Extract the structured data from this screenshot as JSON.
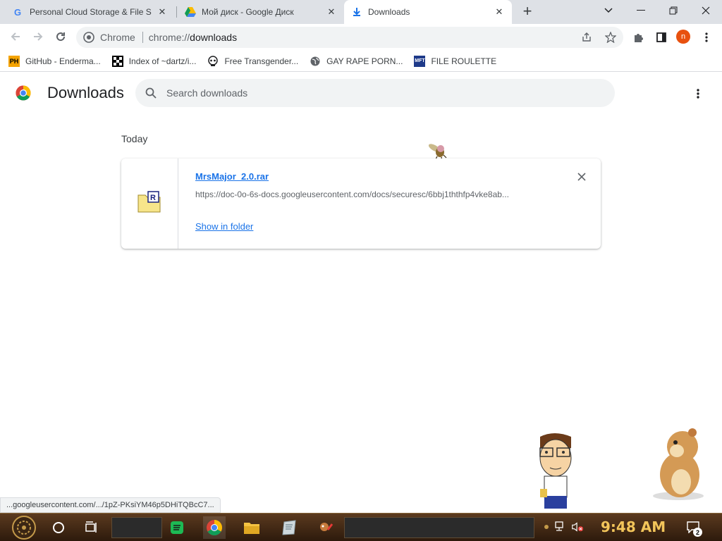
{
  "tabs": [
    {
      "title": "Personal Cloud Storage & File S",
      "favicon": "google-g-icon",
      "active": false
    },
    {
      "title": "Мой диск - Google Диск",
      "favicon": "google-drive-icon",
      "active": false
    },
    {
      "title": "Downloads",
      "favicon": "download-icon",
      "active": true
    }
  ],
  "omnibox": {
    "chip_label": "Chrome",
    "url_prefix": "chrome://",
    "url_host": "downloads"
  },
  "bookmarks": [
    {
      "label": "GitHub - Enderma...",
      "icon": "ph-icon"
    },
    {
      "label": "Index of ~dartz/i...",
      "icon": "pixel-grid-icon"
    },
    {
      "label": "Free Transgender...",
      "icon": "skull-icon"
    },
    {
      "label": "GAY RAPE PORN...",
      "icon": "globe-icon"
    },
    {
      "label": "FILE ROULETTE",
      "icon": "mft-icon"
    }
  ],
  "profile_initial": "n",
  "page": {
    "title": "Downloads",
    "search_placeholder": "Search downloads",
    "section_date": "Today"
  },
  "download": {
    "file_name": "MrsMajor_2.0.rar",
    "url": "https://doc-0o-6s-docs.googleusercontent.com/docs/securesc/6bbj1ththfp4vke8ab...",
    "action_label": "Show in folder"
  },
  "status_bubble": "...googleusercontent.com/.../1pZ-PKsiYM46p5DHiTQBcC7...",
  "taskbar": {
    "clock": "9:48 AM",
    "notification_count": "2"
  },
  "colors": {
    "link": "#1a73e8",
    "tabstrip": "#dee1e6",
    "profile": "#e8510f",
    "clock": "#f3c55a"
  }
}
